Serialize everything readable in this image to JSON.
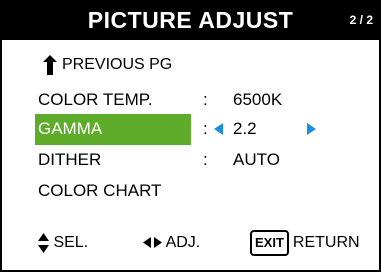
{
  "header": {
    "title": "PICTURE ADJUST",
    "page": "2 / 2"
  },
  "nav": {
    "previous_label": "PREVIOUS PG"
  },
  "menu": {
    "items": [
      {
        "label": "COLOR TEMP.",
        "colon": ":",
        "value": "6500K"
      },
      {
        "label": "GAMMA",
        "colon": ":",
        "value": "2.2",
        "selected": true
      },
      {
        "label": "DITHER",
        "colon": ":",
        "value": "AUTO"
      },
      {
        "label": "COLOR CHART"
      }
    ]
  },
  "footer": {
    "sel_label": "SEL.",
    "adj_label": "ADJ.",
    "exit_key": "EXIT",
    "return_label": "RETURN"
  },
  "colors": {
    "title_bg": "#000000",
    "selection": "#5fab2a",
    "arrow": "#1a8ee0"
  }
}
